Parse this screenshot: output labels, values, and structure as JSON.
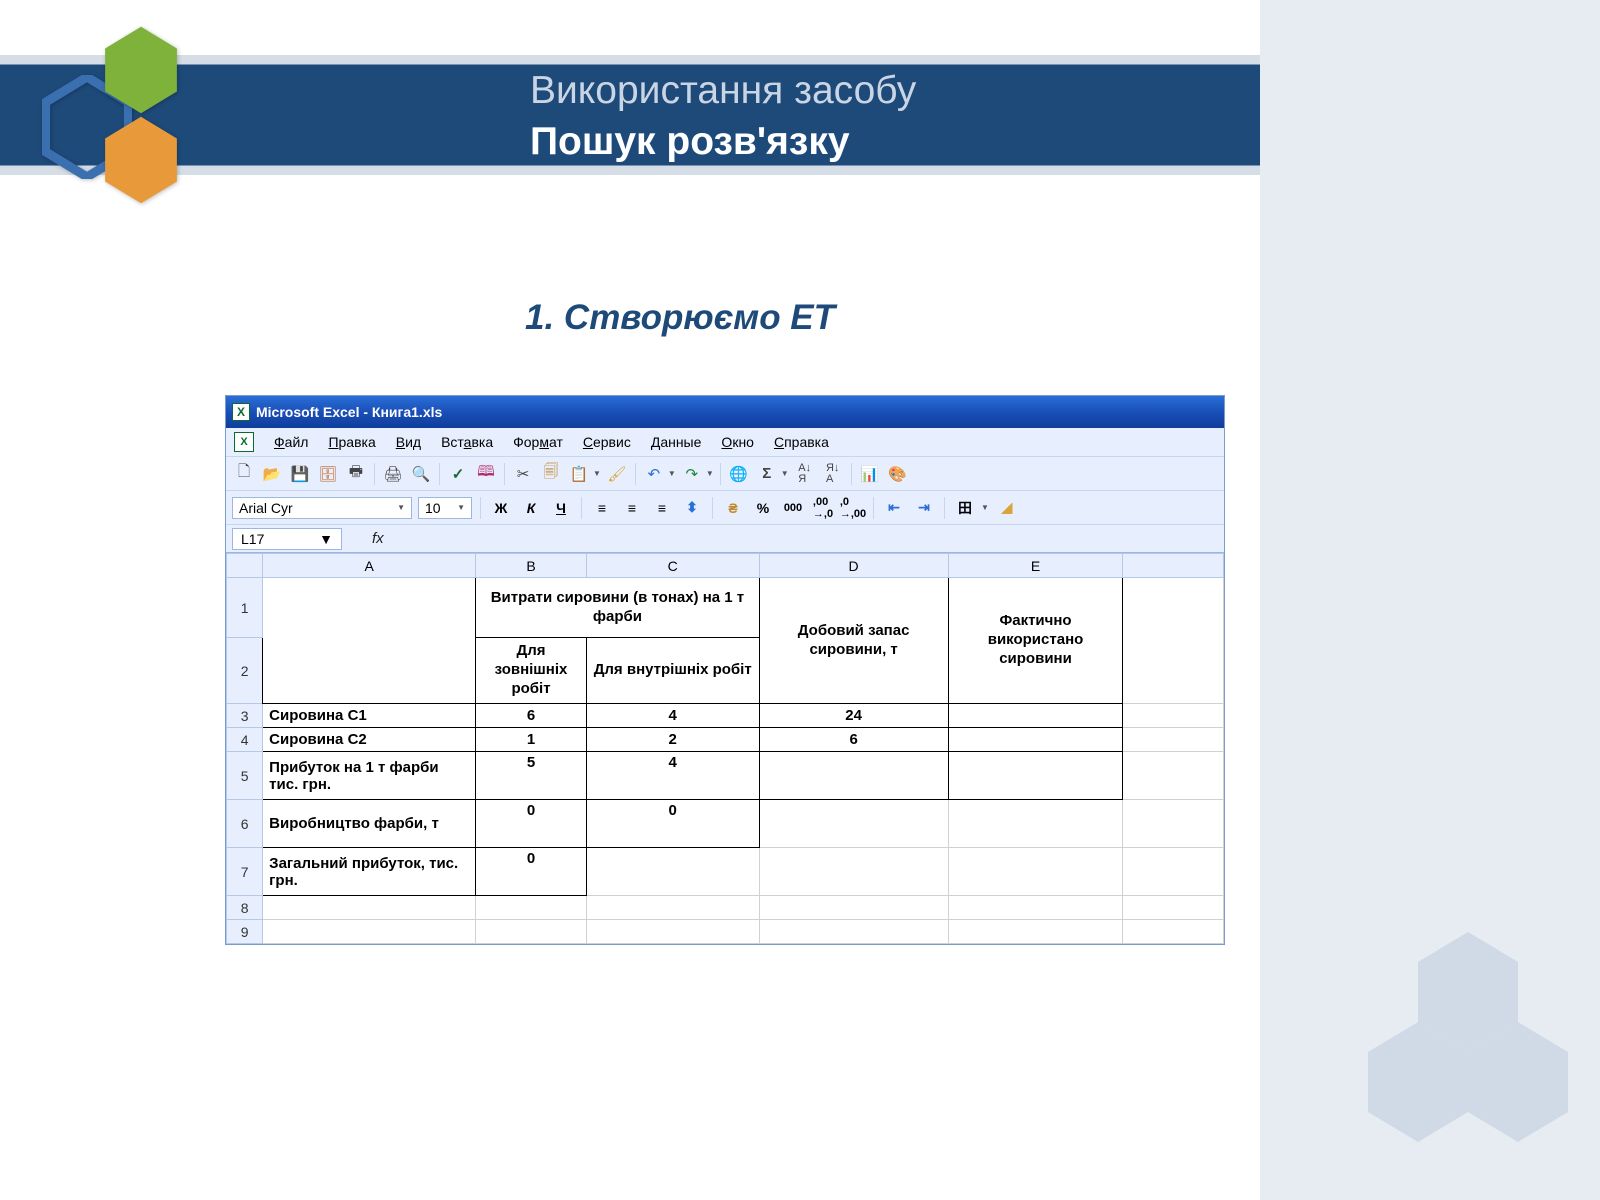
{
  "slide": {
    "title_line1": "Використання засобу",
    "title_line2": "Пошук розв'язку",
    "subtitle": "1. Створюємо ЕТ"
  },
  "excel": {
    "titlebar": "Microsoft Excel - Книга1.xls",
    "menu": [
      "Файл",
      "Правка",
      "Вид",
      "Вставка",
      "Формат",
      "Сервис",
      "Данные",
      "Окно",
      "Справка"
    ],
    "font_name": "Arial Cyr",
    "font_size": "10",
    "bold": "Ж",
    "italic": "К",
    "underline": "Ч",
    "name_box": "L17",
    "fx_label": "fx",
    "columns": [
      "A",
      "B",
      "C",
      "D",
      "E"
    ],
    "row_labels": [
      "1",
      "2",
      "3",
      "4",
      "5",
      "6",
      "7",
      "8",
      "9"
    ],
    "headers": {
      "bc_top": "Витрати сировини (в тонах) на 1 т фарби",
      "b_sub": "Для зовнішніх робіт",
      "c_sub": "Для внутрішніх робіт",
      "d": "Добовий запас сировини, т",
      "e": "Фактично використано сировини"
    },
    "rows": {
      "r3": {
        "a": "Сировина С1",
        "b": "6",
        "c": "4",
        "d": "24",
        "e": ""
      },
      "r4": {
        "a": "Сировина С2",
        "b": "1",
        "c": "2",
        "d": "6",
        "e": ""
      },
      "r5": {
        "a": "Прибуток на 1 т фарби тис. грн.",
        "b": "5",
        "c": "4",
        "d": "",
        "e": ""
      },
      "r6": {
        "a": "Виробництво фарби, т",
        "b": "0",
        "c": "0",
        "d": "",
        "e": ""
      },
      "r7": {
        "a": "Загальний прибуток, тис. грн.",
        "b": "0",
        "c": "",
        "d": "",
        "e": ""
      }
    },
    "percent": "%",
    "thousands": "000",
    "sigma": "Σ"
  }
}
